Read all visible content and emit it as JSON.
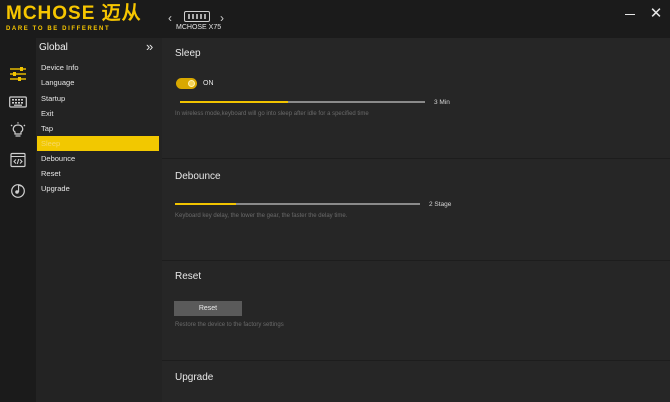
{
  "header": {
    "brand": "MCHOSE 迈从",
    "tagline": "DARE TO BE DIFFERENT",
    "device_name": "MCHOSE X75",
    "prev_label": "‹",
    "next_label": "›",
    "minimize_label": "",
    "close_label": "✕"
  },
  "rail": {
    "items": [
      {
        "icon": "sliders-icon",
        "active": true
      },
      {
        "icon": "keyboard-icon",
        "active": false
      },
      {
        "icon": "lightbulb-icon",
        "active": false
      },
      {
        "icon": "macro-code-icon",
        "active": false
      },
      {
        "icon": "music-disc-icon",
        "active": false
      }
    ],
    "accent": "#f2c400"
  },
  "sidemenu": {
    "title": "Global",
    "collapse_label": "»",
    "items": [
      {
        "label": "Device Info"
      },
      {
        "label": "Language"
      },
      {
        "label": "Startup"
      },
      {
        "label": "Exit"
      },
      {
        "label": "Tap"
      },
      {
        "label": "Sleep",
        "active": true
      },
      {
        "label": "Debounce"
      },
      {
        "label": "Reset"
      },
      {
        "label": "Upgrade"
      }
    ]
  },
  "main": {
    "sleep": {
      "title": "Sleep",
      "toggle_label": "ON",
      "toggle_on": true,
      "slider_fraction": 0.44,
      "value": "3 Min",
      "description": "In wireless mode,keyboard will go into sleep after idle for a specified time"
    },
    "debounce": {
      "title": "Debounce",
      "slider_fraction": 0.25,
      "value": "2 Stage",
      "description": "Keyboard key delay, the lower the gear, the faster the delay time."
    },
    "reset": {
      "title": "Reset",
      "button_label": "Reset",
      "description": "Restore the device to the factory settings"
    },
    "upgrade": {
      "title": "Upgrade"
    }
  },
  "colors": {
    "accent": "#f2c400",
    "background": "#1b1b1b",
    "panel": "#262626"
  }
}
